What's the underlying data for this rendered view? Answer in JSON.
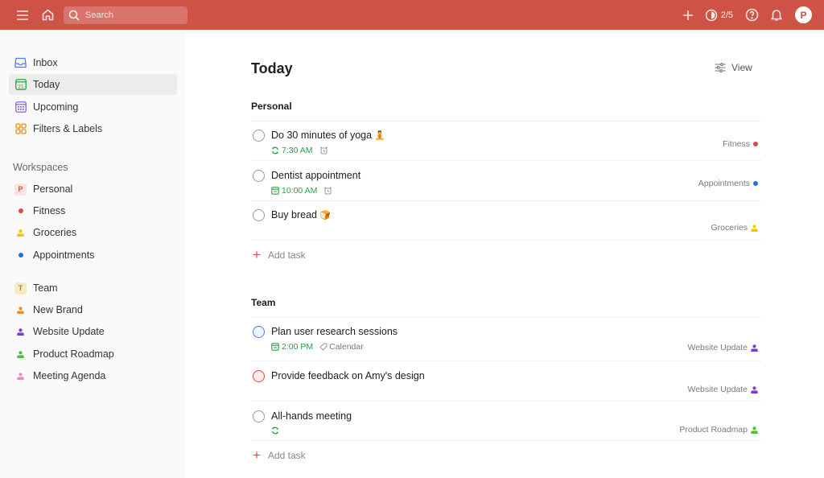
{
  "topbar": {
    "search_placeholder": "Search",
    "karma_progress": "2/5",
    "avatar_initial": "P",
    "icons": [
      "menu-icon",
      "home-icon",
      "search-icon",
      "add-icon",
      "productivity-icon",
      "help-icon",
      "bell-icon"
    ]
  },
  "sidebar": {
    "nav": [
      {
        "label": "Inbox",
        "icon": "inbox-icon",
        "color": "#4c7ef3"
      },
      {
        "label": "Today",
        "icon": "calendar-today-icon",
        "color": "#25a244",
        "active": true,
        "day": "21"
      },
      {
        "label": "Upcoming",
        "icon": "calendar-upcoming-icon",
        "color": "#8b5cf6"
      },
      {
        "label": "Filters & Labels",
        "icon": "filters-icon",
        "color": "#eb8909"
      }
    ],
    "workspaces_label": "Workspaces",
    "personal": {
      "label": "Personal",
      "badge": "P",
      "badge_color": "#dc4c3e",
      "badge_bg": "#fbe3e1",
      "projects": [
        {
          "label": "Fitness",
          "icon": "dot",
          "color": "#dc4c3e"
        },
        {
          "label": "Groceries",
          "icon": "person",
          "color": "#f5c400"
        },
        {
          "label": "Appointments",
          "icon": "dot",
          "color": "#246fe0"
        }
      ]
    },
    "team": {
      "label": "Team",
      "badge": "T",
      "badge_color": "#a48b2f",
      "badge_bg": "#f5ecc7",
      "projects": [
        {
          "label": "New Brand",
          "icon": "person",
          "color": "#ff8a1f"
        },
        {
          "label": "Website Update",
          "icon": "person",
          "color": "#7a3bd9"
        },
        {
          "label": "Product Roadmap",
          "icon": "person",
          "color": "#4dbd3f"
        },
        {
          "label": "Meeting Agenda",
          "icon": "person",
          "color": "#ef8ac8"
        }
      ]
    }
  },
  "main": {
    "title": "Today",
    "view_label": "View",
    "groups": [
      {
        "title": "Personal",
        "tasks": [
          {
            "name": "Do 30 minutes of yoga",
            "emoji": "🧘",
            "due": "7:30 AM",
            "due_icon": "recurring-icon",
            "reminder": true,
            "project": "Fitness",
            "project_icon": "dot",
            "project_color": "#dc4c3e",
            "priority_color": "#999999"
          },
          {
            "name": "Dentist appointment",
            "emoji": "",
            "due": "10:00 AM",
            "due_icon": "calendar-icon",
            "reminder": true,
            "project": "Appointments",
            "project_icon": "dot",
            "project_color": "#246fe0",
            "priority_color": "#999999"
          },
          {
            "name": "Buy bread",
            "emoji": "🍞",
            "due": "",
            "project": "Groceries",
            "project_icon": "person",
            "project_color": "#f5c400",
            "priority_color": "#999999"
          }
        ],
        "add_label": "Add task"
      },
      {
        "title": "Team",
        "tasks": [
          {
            "name": "Plan user research sessions",
            "emoji": "",
            "due": "2:00 PM",
            "due_icon": "calendar-icon",
            "label": "Calendar",
            "project": "Website Update",
            "project_icon": "person",
            "project_color": "#7a3bd9",
            "priority_color": "#4c7ef3"
          },
          {
            "name": "Provide feedback on Amy's design",
            "emoji": "",
            "due": "",
            "project": "Website Update",
            "project_icon": "person",
            "project_color": "#7a3bd9",
            "priority_color": "#dc4c3e"
          },
          {
            "name": "All-hands meeting",
            "emoji": "",
            "due": "",
            "recurring_only": true,
            "project": "Product Roadmap",
            "project_icon": "person",
            "project_color": "#4dbd3f",
            "priority_color": "#999999"
          }
        ],
        "add_label": "Add task"
      }
    ]
  }
}
